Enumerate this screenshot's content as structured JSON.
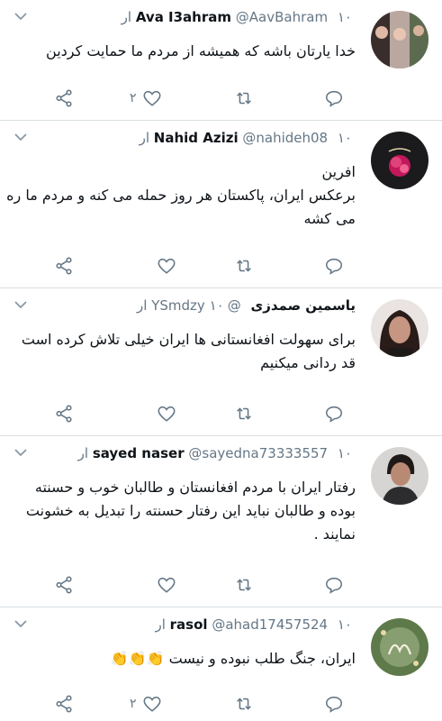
{
  "tweets": [
    {
      "name": "Ava I3ahram",
      "handle": "@AavBahram",
      "time": "۱۰ ار",
      "lines": [
        "خدا یارتان باشه که همیشه از مردم ما حمایت کردین"
      ],
      "like_count": "۲",
      "avatar": "group-photo"
    },
    {
      "name": "Nahid Azizi",
      "handle": "@nahideh08",
      "time": "۱۰ ار",
      "lines": [
        "افرین",
        "برعکس ایران، پاکستان هر روز حمله می کنه و مردم ما ره",
        "می کشه"
      ],
      "like_count": "",
      "avatar": "flower-photo"
    },
    {
      "name": "یاسمین صمدزی",
      "handle": "@YSmdzy",
      "time": "۱۰ ار",
      "lines": [
        "برای سهولت افغانستانی ها ایران خیلی تلاش کرده است",
        "قد ردانی میکنیم"
      ],
      "like_count": "",
      "avatar": "woman-photo"
    },
    {
      "name": "sayed naser",
      "handle": "@sayedna73333557",
      "time": "۱۰ ار",
      "lines": [
        "رفتار ایران با مردم افغانستان و طالبان خوب و حسنته",
        "بوده و طالبان نباید این رفتار حسنته را تبدیل به خشونت",
        "نمایند ."
      ],
      "like_count": "",
      "avatar": "man-photo"
    },
    {
      "name": "rasol",
      "handle": "@ahad17457524",
      "time": "۱۰ ار",
      "lines": [
        "ایران، جنگ طلب نبوده و نیست"
      ],
      "emoji": "👏👏👏",
      "like_count": "۲",
      "avatar": "calligraphy-photo"
    }
  ],
  "colors": {
    "icon": "#657786",
    "divider": "#d9dee2",
    "text": "#0f1419"
  }
}
